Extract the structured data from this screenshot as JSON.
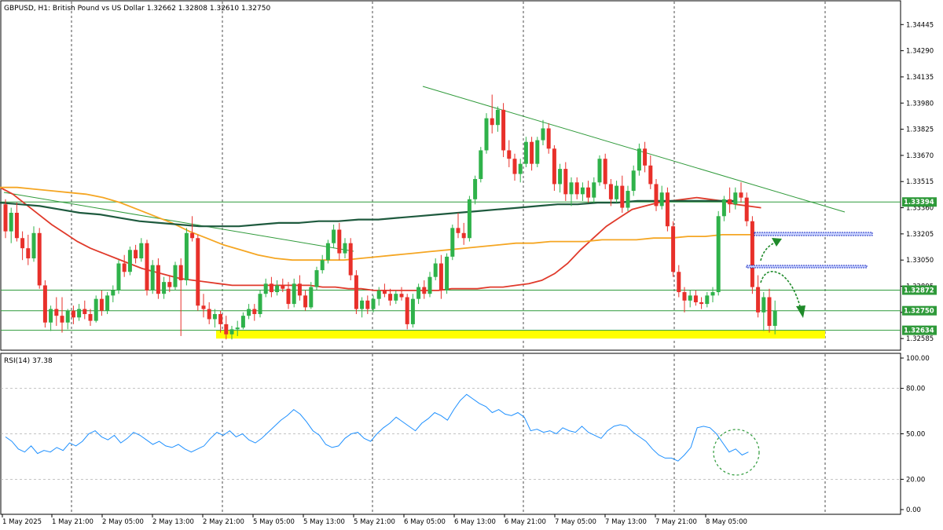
{
  "header": {
    "title": "GBPUSD, H1:  British Pound vs US Dollar  1.32662 1.32808 1.32610 1.32750"
  },
  "chart_data": {
    "type": "candlestick",
    "symbol": "GBPUSD",
    "timeframe": "H1",
    "ohlc": {
      "open": 1.32662,
      "high": 1.32808,
      "low": 1.3261,
      "close": 1.3275
    },
    "price_axis": {
      "ylim": [
        1.3253,
        1.3453
      ],
      "ticks": [
        "1.34445",
        "1.34290",
        "1.34135",
        "1.33980",
        "1.33825",
        "1.33670",
        "1.33515",
        "1.33360",
        "1.33205",
        "1.33050",
        "1.32895",
        "1.32740",
        "1.32585"
      ]
    },
    "time_axis": {
      "labels": [
        "1 May 2025",
        "1 May 21:00",
        "2 May 05:00",
        "2 May 13:00",
        "2 May 21:00",
        "5 May 05:00",
        "5 May 13:00",
        "5 May 21:00",
        "6 May 05:00",
        "6 May 13:00",
        "6 May 21:00",
        "7 May 05:00",
        "7 May 13:00",
        "7 May 21:00",
        "8 May 05:00"
      ]
    },
    "candles": [
      [
        1.3338,
        1.3341,
        1.3318,
        1.3322
      ],
      [
        1.3322,
        1.3336,
        1.3315,
        1.3333
      ],
      [
        1.3333,
        1.3339,
        1.3316,
        1.3318
      ],
      [
        1.3318,
        1.3322,
        1.3305,
        1.3312
      ],
      [
        1.3312,
        1.332,
        1.3302,
        1.3306
      ],
      [
        1.3306,
        1.3325,
        1.3304,
        1.3321
      ],
      [
        1.3321,
        1.3324,
        1.3288,
        1.329
      ],
      [
        1.329,
        1.3293,
        1.3265,
        1.3268
      ],
      [
        1.3268,
        1.3278,
        1.3263,
        1.3276
      ],
      [
        1.3276,
        1.3283,
        1.3266,
        1.3272
      ],
      [
        1.3272,
        1.3283,
        1.3262,
        1.3268
      ],
      [
        1.3268,
        1.3276,
        1.3264,
        1.3275
      ],
      [
        1.3275,
        1.3278,
        1.3267,
        1.3271
      ],
      [
        1.3271,
        1.3279,
        1.3269,
        1.3276
      ],
      [
        1.3276,
        1.3281,
        1.327,
        1.3273
      ],
      [
        1.3273,
        1.3276,
        1.3266,
        1.3269
      ],
      [
        1.3269,
        1.3284,
        1.3268,
        1.3282
      ],
      [
        1.3282,
        1.3287,
        1.3272,
        1.3275
      ],
      [
        1.3275,
        1.3286,
        1.3273,
        1.3284
      ],
      [
        1.3284,
        1.329,
        1.328,
        1.3287
      ],
      [
        1.3287,
        1.3305,
        1.3285,
        1.3303
      ],
      [
        1.3303,
        1.3308,
        1.3295,
        1.3298
      ],
      [
        1.3298,
        1.3313,
        1.3296,
        1.3311
      ],
      [
        1.3311,
        1.3314,
        1.3303,
        1.3306
      ],
      [
        1.3306,
        1.3318,
        1.3304,
        1.3315
      ],
      [
        1.3315,
        1.3317,
        1.3284,
        1.3287
      ],
      [
        1.3287,
        1.3305,
        1.3285,
        1.3302
      ],
      [
        1.3302,
        1.3306,
        1.3282,
        1.3285
      ],
      [
        1.3285,
        1.3295,
        1.3282,
        1.3292
      ],
      [
        1.3292,
        1.3296,
        1.3286,
        1.3289
      ],
      [
        1.3289,
        1.3304,
        1.3287,
        1.3302
      ],
      [
        1.3302,
        1.3306,
        1.326,
        1.3293
      ],
      [
        1.3293,
        1.3324,
        1.329,
        1.3321
      ],
      [
        1.3321,
        1.3331,
        1.3316,
        1.3318
      ],
      [
        1.3318,
        1.332,
        1.3275,
        1.3278
      ],
      [
        1.3278,
        1.3285,
        1.3271,
        1.3276
      ],
      [
        1.3276,
        1.328,
        1.3267,
        1.327
      ],
      [
        1.327,
        1.3276,
        1.3265,
        1.3273
      ],
      [
        1.3273,
        1.3275,
        1.3262,
        1.3267
      ],
      [
        1.3267,
        1.3272,
        1.3258,
        1.3261
      ],
      [
        1.3261,
        1.3266,
        1.3258,
        1.3264
      ],
      [
        1.3264,
        1.3269,
        1.326,
        1.3265
      ],
      [
        1.3265,
        1.3274,
        1.3264,
        1.3272
      ],
      [
        1.3272,
        1.3279,
        1.327,
        1.3276
      ],
      [
        1.3276,
        1.3279,
        1.3269,
        1.3273
      ],
      [
        1.3273,
        1.3287,
        1.3271,
        1.3285
      ],
      [
        1.3285,
        1.3294,
        1.3283,
        1.3291
      ],
      [
        1.3291,
        1.3295,
        1.3283,
        1.3286
      ],
      [
        1.3286,
        1.3293,
        1.3284,
        1.329
      ],
      [
        1.329,
        1.3294,
        1.3286,
        1.3288
      ],
      [
        1.3288,
        1.3292,
        1.3276,
        1.3279
      ],
      [
        1.3279,
        1.3294,
        1.3277,
        1.3291
      ],
      [
        1.3291,
        1.3296,
        1.3281,
        1.3284
      ],
      [
        1.3284,
        1.3287,
        1.3275,
        1.3277
      ],
      [
        1.3277,
        1.3292,
        1.3276,
        1.3289
      ],
      [
        1.3289,
        1.3301,
        1.3287,
        1.3299
      ],
      [
        1.3299,
        1.3308,
        1.3297,
        1.3305
      ],
      [
        1.3305,
        1.3317,
        1.3303,
        1.3315
      ],
      [
        1.3315,
        1.3326,
        1.3312,
        1.3323
      ],
      [
        1.3323,
        1.3327,
        1.3305,
        1.3309
      ],
      [
        1.3309,
        1.3318,
        1.3306,
        1.3315
      ],
      [
        1.3315,
        1.3318,
        1.3293,
        1.3296
      ],
      [
        1.3296,
        1.3299,
        1.3273,
        1.3276
      ],
      [
        1.3276,
        1.3283,
        1.3271,
        1.3281
      ],
      [
        1.3281,
        1.3284,
        1.3273,
        1.3276
      ],
      [
        1.3276,
        1.3284,
        1.3274,
        1.3282
      ],
      [
        1.3282,
        1.3289,
        1.3278,
        1.3287
      ],
      [
        1.3287,
        1.3291,
        1.3283,
        1.3285
      ],
      [
        1.3285,
        1.3288,
        1.3278,
        1.3281
      ],
      [
        1.3281,
        1.3287,
        1.3279,
        1.3285
      ],
      [
        1.3285,
        1.3289,
        1.3281,
        1.3283
      ],
      [
        1.3283,
        1.3285,
        1.3264,
        1.3267
      ],
      [
        1.3267,
        1.3285,
        1.3265,
        1.3282
      ],
      [
        1.3282,
        1.3291,
        1.3279,
        1.3289
      ],
      [
        1.3289,
        1.3293,
        1.3282,
        1.3285
      ],
      [
        1.3285,
        1.3298,
        1.3283,
        1.3295
      ],
      [
        1.3295,
        1.3306,
        1.3293,
        1.3303
      ],
      [
        1.3303,
        1.3308,
        1.3282,
        1.3287
      ],
      [
        1.3287,
        1.3309,
        1.3285,
        1.3307
      ],
      [
        1.3307,
        1.3326,
        1.3305,
        1.3324
      ],
      [
        1.3324,
        1.3333,
        1.3318,
        1.3321
      ],
      [
        1.3321,
        1.3327,
        1.3314,
        1.3318
      ],
      [
        1.3318,
        1.3343,
        1.3316,
        1.3341
      ],
      [
        1.3341,
        1.3355,
        1.3338,
        1.3353
      ],
      [
        1.3353,
        1.3372,
        1.3351,
        1.337
      ],
      [
        1.337,
        1.3392,
        1.3368,
        1.3389
      ],
      [
        1.3389,
        1.3403,
        1.338,
        1.3385
      ],
      [
        1.3385,
        1.3396,
        1.3381,
        1.3394
      ],
      [
        1.3394,
        1.3398,
        1.3366,
        1.337
      ],
      [
        1.337,
        1.3376,
        1.336,
        1.3365
      ],
      [
        1.3365,
        1.3368,
        1.3352,
        1.3356
      ],
      [
        1.3356,
        1.3365,
        1.3351,
        1.3362
      ],
      [
        1.3362,
        1.3378,
        1.336,
        1.3375
      ],
      [
        1.3375,
        1.3378,
        1.3358,
        1.3362
      ],
      [
        1.3362,
        1.3378,
        1.336,
        1.3376
      ],
      [
        1.3376,
        1.3388,
        1.3373,
        1.3383
      ],
      [
        1.3383,
        1.3386,
        1.3368,
        1.3371
      ],
      [
        1.3371,
        1.3373,
        1.3346,
        1.335
      ],
      [
        1.335,
        1.3362,
        1.3345,
        1.3359
      ],
      [
        1.3359,
        1.3363,
        1.334,
        1.3344
      ],
      [
        1.3344,
        1.3354,
        1.3337,
        1.3351
      ],
      [
        1.3351,
        1.3354,
        1.3341,
        1.3344
      ],
      [
        1.3344,
        1.3351,
        1.334,
        1.3348
      ],
      [
        1.3348,
        1.3352,
        1.3339,
        1.3342
      ],
      [
        1.3342,
        1.3354,
        1.3339,
        1.3351
      ],
      [
        1.3351,
        1.3367,
        1.3349,
        1.3365
      ],
      [
        1.3365,
        1.3368,
        1.3347,
        1.335
      ],
      [
        1.335,
        1.3353,
        1.3337,
        1.3341
      ],
      [
        1.3341,
        1.3352,
        1.3339,
        1.3349
      ],
      [
        1.3349,
        1.3355,
        1.3333,
        1.3336
      ],
      [
        1.3336,
        1.3349,
        1.3334,
        1.3346
      ],
      [
        1.3346,
        1.3361,
        1.3343,
        1.3358
      ],
      [
        1.3358,
        1.3374,
        1.3355,
        1.3371
      ],
      [
        1.3371,
        1.3375,
        1.3357,
        1.3361
      ],
      [
        1.3361,
        1.3367,
        1.3347,
        1.335
      ],
      [
        1.335,
        1.3353,
        1.3334,
        1.3337
      ],
      [
        1.3337,
        1.3349,
        1.3335,
        1.3345
      ],
      [
        1.3345,
        1.3348,
        1.3322,
        1.3325
      ],
      [
        1.3325,
        1.3328,
        1.3295,
        1.3298
      ],
      [
        1.3298,
        1.3302,
        1.3283,
        1.3286
      ],
      [
        1.3286,
        1.3289,
        1.3274,
        1.3281
      ],
      [
        1.3281,
        1.3287,
        1.3277,
        1.3284
      ],
      [
        1.3284,
        1.3287,
        1.3278,
        1.328
      ],
      [
        1.328,
        1.3283,
        1.3276,
        1.3279
      ],
      [
        1.3279,
        1.3286,
        1.3277,
        1.3284
      ],
      [
        1.3284,
        1.3289,
        1.328,
        1.3286
      ],
      [
        1.3286,
        1.3334,
        1.3284,
        1.3331
      ],
      [
        1.3331,
        1.3343,
        1.3328,
        1.3341
      ],
      [
        1.3341,
        1.3348,
        1.3333,
        1.3338
      ],
      [
        1.3338,
        1.3348,
        1.3335,
        1.3345
      ],
      [
        1.3345,
        1.3351,
        1.3339,
        1.3342
      ],
      [
        1.3342,
        1.3345,
        1.3325,
        1.3328
      ],
      [
        1.3328,
        1.3331,
        1.3285,
        1.3289
      ],
      [
        1.3289,
        1.3296,
        1.3271,
        1.3274
      ],
      [
        1.3274,
        1.3286,
        1.3263,
        1.3283
      ],
      [
        1.3283,
        1.3288,
        1.3262,
        1.3266
      ],
      [
        1.3266,
        1.3281,
        1.3261,
        1.3275
      ]
    ],
    "moving_averages": [
      {
        "color": "#e03a2b",
        "values": [
          1.3348,
          1.3344,
          1.3338,
          1.3332,
          1.3326,
          1.3321,
          1.3316,
          1.3312,
          1.3309,
          1.3306,
          1.3303,
          1.33,
          1.3298,
          1.3296,
          1.3294,
          1.3293,
          1.3292,
          1.3291,
          1.329,
          1.329,
          1.329,
          1.329,
          1.329,
          1.329,
          1.329,
          1.3289,
          1.3289,
          1.3288,
          1.3288,
          1.3287,
          1.3287,
          1.3287,
          1.3287,
          1.3287,
          1.3287,
          1.3288,
          1.3288,
          1.3288,
          1.3289,
          1.3289,
          1.329,
          1.3291,
          1.3293,
          1.3297,
          1.3303,
          1.3311,
          1.3318,
          1.3325,
          1.333,
          1.3335,
          1.3337,
          1.3339,
          1.334,
          1.3341,
          1.3342,
          1.3341,
          1.334,
          1.3338,
          1.3337,
          1.3336
        ]
      },
      {
        "color": "#f5a623",
        "values": [
          1.3348,
          1.3348,
          1.3347,
          1.3346,
          1.3345,
          1.3344,
          1.3342,
          1.3339,
          1.3335,
          1.3331,
          1.3327,
          1.3322,
          1.3318,
          1.3314,
          1.3311,
          1.3308,
          1.3306,
          1.3305,
          1.3305,
          1.3305,
          1.3305,
          1.3306,
          1.3307,
          1.3308,
          1.3309,
          1.331,
          1.3311,
          1.3312,
          1.3313,
          1.3314,
          1.3315,
          1.3315,
          1.3316,
          1.3316,
          1.3316,
          1.3317,
          1.3317,
          1.3317,
          1.3318,
          1.3318,
          1.3319,
          1.3319,
          1.332,
          1.332,
          1.332
        ]
      },
      {
        "color": "#1e5a3e",
        "values": [
          1.3339,
          1.3338,
          1.3337,
          1.3335,
          1.3333,
          1.3332,
          1.333,
          1.3328,
          1.3327,
          1.3326,
          1.3325,
          1.3325,
          1.3325,
          1.3326,
          1.3327,
          1.3327,
          1.3328,
          1.3328,
          1.3329,
          1.3329,
          1.333,
          1.3331,
          1.3332,
          1.3333,
          1.3334,
          1.3335,
          1.3336,
          1.3337,
          1.3338,
          1.3338,
          1.3339,
          1.3339,
          1.334,
          1.334,
          1.334,
          1.334,
          1.334,
          1.334
        ]
      }
    ],
    "horizontal_levels": [
      {
        "price": 1.33394,
        "label": "1.33394"
      },
      {
        "price": 1.32872,
        "label": "1.32872"
      },
      {
        "price": 1.3275,
        "label": "1.32750"
      },
      {
        "price": 1.32634,
        "label": "1.32634"
      }
    ],
    "support_zone": {
      "from": 1.32585,
      "to": 1.32634,
      "color": "#ffff00"
    },
    "rsi": {
      "label": "RSI(14) 37.38",
      "period": 14,
      "value": 37.38,
      "ylim": [
        0,
        100
      ],
      "levels": [
        80,
        50,
        20
      ],
      "ticks": [
        "100.00",
        "80.00",
        "50.00",
        "20.00",
        "0.00"
      ],
      "values": [
        48,
        45,
        40,
        38,
        42,
        37,
        39,
        38,
        41,
        39,
        44,
        42,
        45,
        50,
        52,
        48,
        46,
        49,
        44,
        47,
        51,
        49,
        46,
        43,
        45,
        42,
        41,
        43,
        40,
        38,
        40,
        42,
        47,
        51,
        49,
        52,
        48,
        50,
        46,
        44,
        47,
        51,
        55,
        59,
        62,
        66,
        63,
        58,
        52,
        49,
        43,
        41,
        42,
        47,
        50,
        51,
        47,
        45,
        50,
        54,
        57,
        61,
        58,
        55,
        52,
        57,
        60,
        64,
        62,
        59,
        66,
        72,
        76,
        73,
        70,
        68,
        64,
        66,
        63,
        62,
        64,
        61,
        52,
        53,
        51,
        52,
        50,
        54,
        52,
        51,
        55,
        51,
        49,
        47,
        52,
        55,
        56,
        55,
        51,
        48,
        45,
        40,
        36,
        34,
        34,
        32,
        36,
        41,
        54,
        55,
        54,
        50,
        44,
        38,
        40,
        36,
        38
      ]
    }
  }
}
